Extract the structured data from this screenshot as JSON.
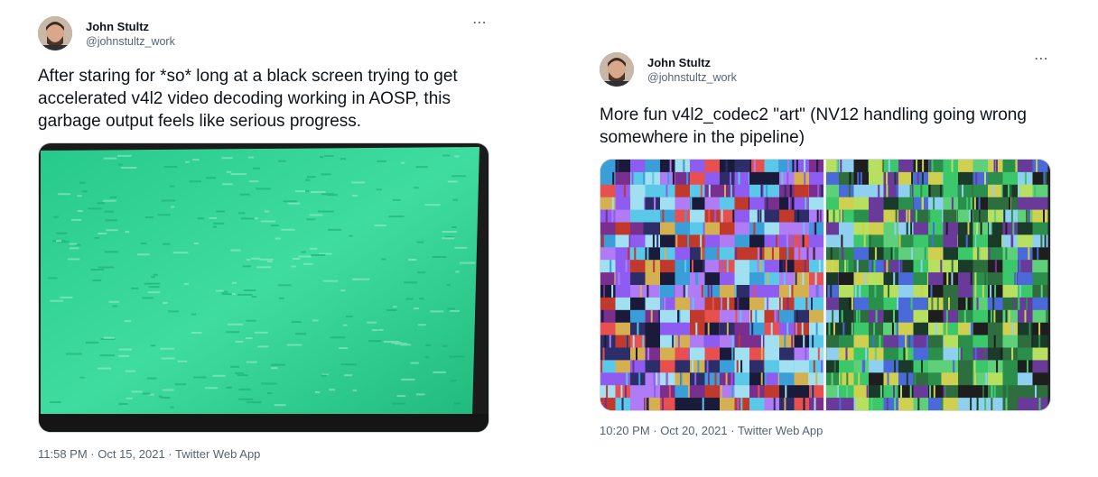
{
  "tweets": [
    {
      "author_name": "John Stultz",
      "author_handle": "@johnstultz_work",
      "more_icon": "⋯",
      "text": "After staring for *so* long at a black screen trying to get accelerated v4l2 video decoding working in AOSP, this garbage output feels like serious progress.",
      "timestamp": "11:58 PM · Oct 15, 2021 · Twitter Web App"
    },
    {
      "author_name": "John Stultz",
      "author_handle": "@johnstultz_work",
      "more_icon": "⋯",
      "text": "More fun v4l2_codec2 \"art\" (NV12 handling going wrong somewhere in the pipeline)",
      "timestamp": "10:20 PM · Oct 20, 2021 · Twitter Web App"
    }
  ],
  "colors": {
    "text_primary": "#0f1419",
    "text_secondary": "#536471",
    "border": "#cfd9de",
    "screen_green": "#2fcf8f"
  }
}
